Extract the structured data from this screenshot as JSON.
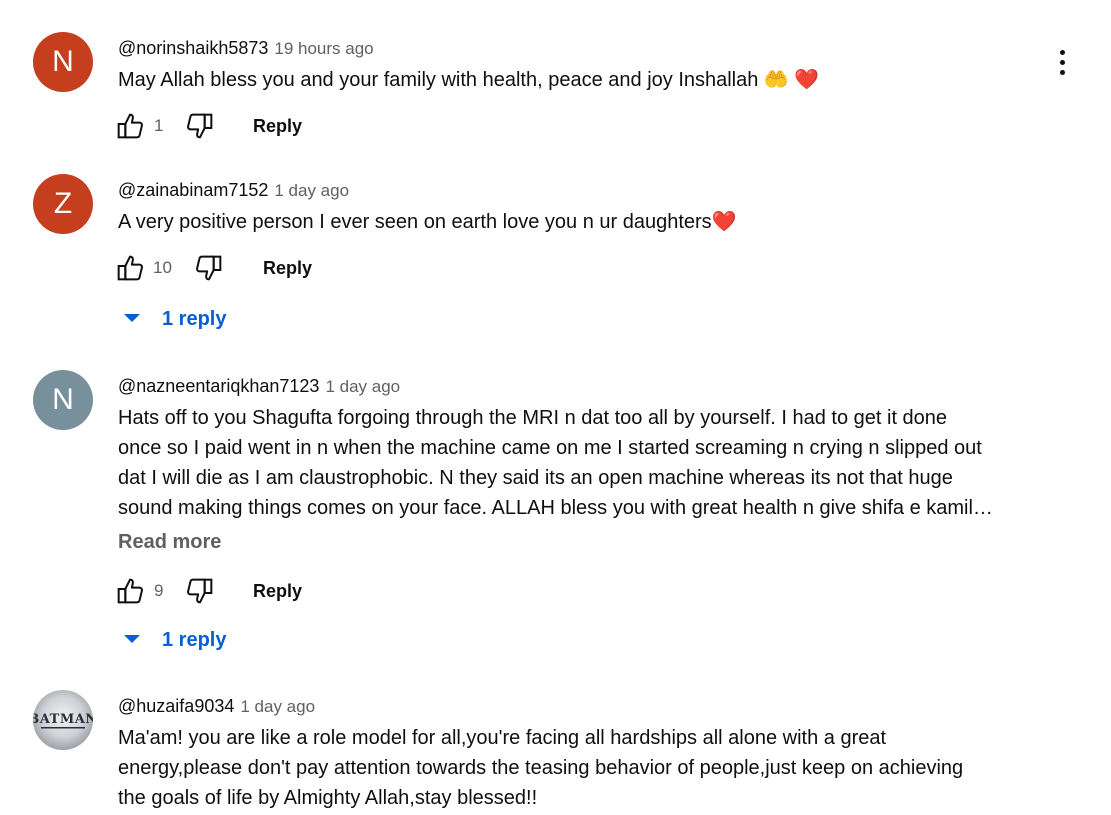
{
  "colors": {
    "avatar_n1": "#c53e1d",
    "avatar_z": "#c53e1d",
    "avatar_n2": "#78909c",
    "link_blue": "#065fd4",
    "secondary_text": "#606060"
  },
  "comments": [
    {
      "author": "@norinshaikh5873",
      "time": "19 hours ago",
      "avatar_letter": "N",
      "text_lines": [
        "May Allah bless you and your family with health, peace and joy Inshallah  🤲 ❤️"
      ],
      "likes": "1",
      "reply_label": "Reply"
    },
    {
      "author": "@zainabinam7152",
      "time": "1 day ago",
      "avatar_letter": "Z",
      "text_lines": [
        "A very positive person I ever seen on earth love you n ur daughters❤️"
      ],
      "likes": "10",
      "reply_label": "Reply",
      "replies_label": "1 reply"
    },
    {
      "author": "@nazneentariqkhan7123",
      "time": "1 day ago",
      "avatar_letter": "N",
      "text_lines": [
        "Hats off to you Shagufta forgoing through the MRI n dat too all by yourself. I had to get it done",
        "once so I paid went in n when the machine came on me I started screaming n crying n slipped out",
        "dat I will die as I am claustrophobic. N they said its an open machine whereas its not that huge",
        "sound making things comes on your face. ALLAH bless you with great health n give shifa e kamil…"
      ],
      "read_more": "Read more",
      "likes": "9",
      "reply_label": "Reply",
      "replies_label": "1 reply"
    },
    {
      "author": "@huzaifa9034",
      "time": "1 day ago",
      "avatar_text": "BATMAN",
      "text_lines": [
        "Ma'am! you are like a role model for all,you're facing all hardships all alone with a great",
        "energy,please don't pay attention towards the teasing behavior of people,just keep on achieving",
        "the goals of life by Almighty Allah,stay blessed!!"
      ]
    }
  ],
  "icons": {
    "like": "thumb-up-icon",
    "dislike": "thumb-down-icon",
    "menu": "more-vert-icon",
    "expand": "caret-down-icon"
  }
}
